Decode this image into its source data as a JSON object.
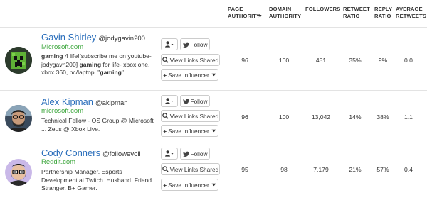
{
  "columns": {
    "page_authority": "PAGE AUTHORITY",
    "domain_authority": "DOMAIN AUTHORITY",
    "followers": "FOLLOWERS",
    "retweet_ratio": "RETWEET RATIO",
    "reply_ratio": "REPLY RATIO",
    "average_retweets": "AVERAGE RETWEETS"
  },
  "buttons": {
    "follow": "Follow",
    "view_links": "View Links Shared",
    "save": "Save Influencer"
  },
  "influencers": [
    {
      "name": "Gavin Shirley",
      "handle": "@jodygavin200",
      "site": "Microsoft.com",
      "bio_parts": [
        {
          "text": "gaming",
          "bold": true
        },
        {
          "text": " 4 life![subscribe me on youtube- jodygavn200] ",
          "bold": false
        },
        {
          "text": "gaming",
          "bold": true
        },
        {
          "text": " for life- xbox one, xbox 360, pc/laptop. \"",
          "bold": false
        },
        {
          "text": "gaming",
          "bold": true
        },
        {
          "text": "\"",
          "bold": false
        }
      ],
      "page_authority": "96",
      "domain_authority": "100",
      "followers": "451",
      "retweet_ratio": "35%",
      "reply_ratio": "9%",
      "average_retweets": "0.0"
    },
    {
      "name": "Alex Kipman",
      "handle": "@akipman",
      "site": "microsoft.com",
      "bio_parts": [
        {
          "text": "Technical Fellow - OS Group @ Microsoft ... Zeus @ Xbox Live.",
          "bold": false
        }
      ],
      "page_authority": "96",
      "domain_authority": "100",
      "followers": "13,042",
      "retweet_ratio": "14%",
      "reply_ratio": "38%",
      "average_retweets": "1.1"
    },
    {
      "name": "Cody Conners",
      "handle": "@followevoli",
      "site": "Reddit.com",
      "bio_parts": [
        {
          "text": "Partnership Manager, Esports Development at Twitch. Husband. Friend. Stranger. B+ Gamer.",
          "bold": false
        }
      ],
      "page_authority": "95",
      "domain_authority": "98",
      "followers": "7,179",
      "retweet_ratio": "21%",
      "reply_ratio": "57%",
      "average_retweets": "0.4"
    }
  ],
  "colors": {
    "name_link": "#2a6ebb",
    "site_link": "#3aa53a",
    "border": "#cccccc"
  }
}
